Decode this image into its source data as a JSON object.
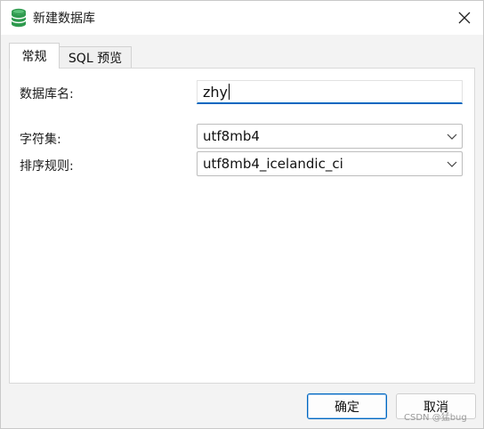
{
  "window": {
    "title": "新建数据库",
    "icon": "database-icon",
    "close_icon": "close-icon"
  },
  "tabs": [
    {
      "label": "常规",
      "active": true
    },
    {
      "label": "SQL 预览",
      "active": false
    }
  ],
  "form": {
    "db_name_label": "数据库名:",
    "db_name_value": "zhy",
    "charset_label": "字符集:",
    "charset_value": "utf8mb4",
    "collation_label": "排序规则:",
    "collation_value": "utf8mb4_icelandic_ci"
  },
  "buttons": {
    "ok": "确定",
    "cancel": "取消"
  },
  "watermark": "CSDN @猛bug",
  "colors": {
    "accent": "#0067c0",
    "icon_green": "#2e9a4e"
  }
}
